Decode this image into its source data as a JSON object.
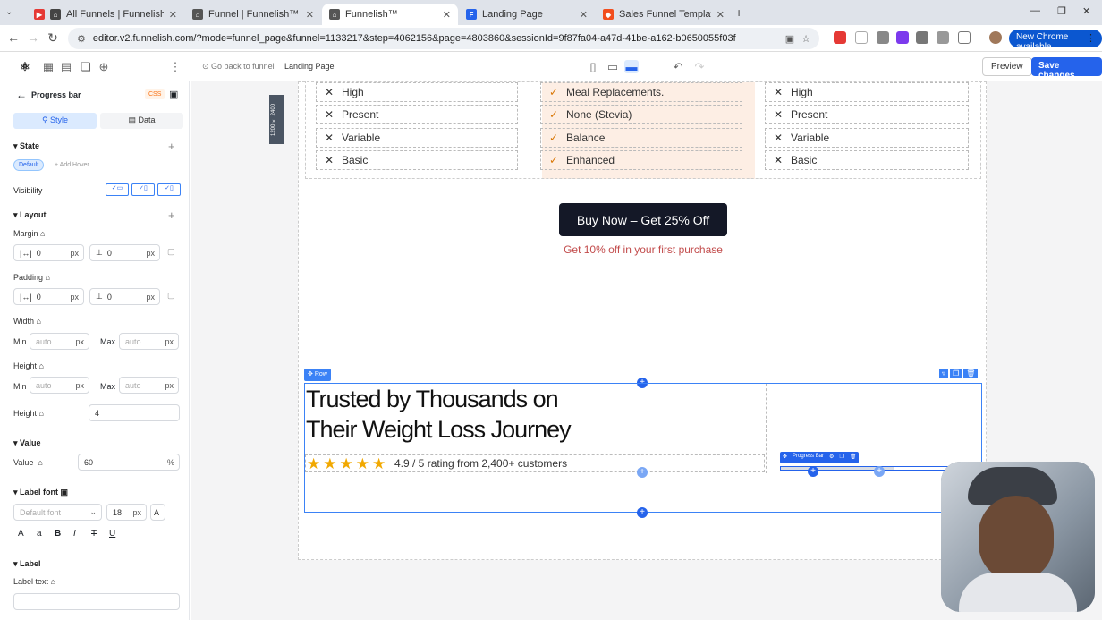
{
  "browser": {
    "tabs": [
      {
        "label": "All Funnels | Funnelish™",
        "active": false,
        "favicon_color": "#e53935"
      },
      {
        "label": "Funnel | Funnelish™",
        "active": false,
        "favicon_color": "#555555"
      },
      {
        "label": "Funnelish™",
        "active": true,
        "favicon_color": "#555555"
      },
      {
        "label": "Landing Page",
        "active": false,
        "favicon_color": "#2563eb"
      },
      {
        "label": "Sales Funnel Template – Figma",
        "active": false,
        "favicon_color": "#f24e1e"
      }
    ],
    "url": "editor.v2.funnelish.com/?mode=funnel_page&funnel=1133217&step=4062156&page=4803860&sessionId=9f87fa04-a47d-41be-a162-b0650055f03f",
    "new_chrome_label": "New Chrome available"
  },
  "editor": {
    "back_link": "Go back to funnel",
    "page_name": "Landing Page",
    "preview_label": "Preview",
    "save_label": "Save changes"
  },
  "panel": {
    "title": "Progress bar",
    "css_badge": "CSS",
    "tabs": {
      "style": "Style",
      "data": "Data"
    },
    "state": {
      "title": "State",
      "default": "Default",
      "add_hover": "+ Add Hover"
    },
    "visibility": "Visibility",
    "layout": {
      "title": "Layout",
      "margin": "Margin",
      "padding": "Padding",
      "width": "Width",
      "height": "Height",
      "height2": "Height"
    },
    "margin_values": {
      "left": "0",
      "top": "0",
      "unit": "px"
    },
    "padding_values": {
      "left": "0",
      "top": "0",
      "unit": "px"
    },
    "width": {
      "min_label": "Min",
      "min": "auto",
      "max_label": "Max",
      "max": "auto",
      "unit": "px"
    },
    "height_minmax": {
      "min_label": "Min",
      "min": "auto",
      "max_label": "Max",
      "max": "auto",
      "unit": "px"
    },
    "height_value": "4",
    "value_section": {
      "title": "Value",
      "label": "Value",
      "value": "60",
      "unit": "%"
    },
    "label_font": {
      "title": "Label font",
      "font": "Default font",
      "size": "18",
      "unit": "px"
    },
    "label": {
      "title": "Label",
      "text_label": "Label text"
    }
  },
  "canvas": {
    "size_badge": "1200 × 2400",
    "comparison": {
      "col1": [
        "High",
        "Present",
        "Variable",
        "Basic"
      ],
      "col2": [
        "Meal Replacements.",
        "None (Stevia)",
        "Balance",
        "Enhanced"
      ],
      "col3": [
        "High",
        "Present",
        "Variable",
        "Basic"
      ]
    },
    "buy_button": "Buy Now – Get 25% Off",
    "discount_text": "Get 10% off in your first purchase",
    "row_tag": "Row",
    "headline": "Trusted by Thousands on\nTheir Weight Loss Journey",
    "rating_text": "4.9 / 5 rating from 2,400+ customers",
    "star_count": 5,
    "progress_tag": "Progress Bar",
    "progress_value": 60
  },
  "colors": {
    "accent": "#2563eb",
    "discount": "#c24b4b",
    "button": "#141827",
    "highlight_col": "#fdeee4"
  }
}
